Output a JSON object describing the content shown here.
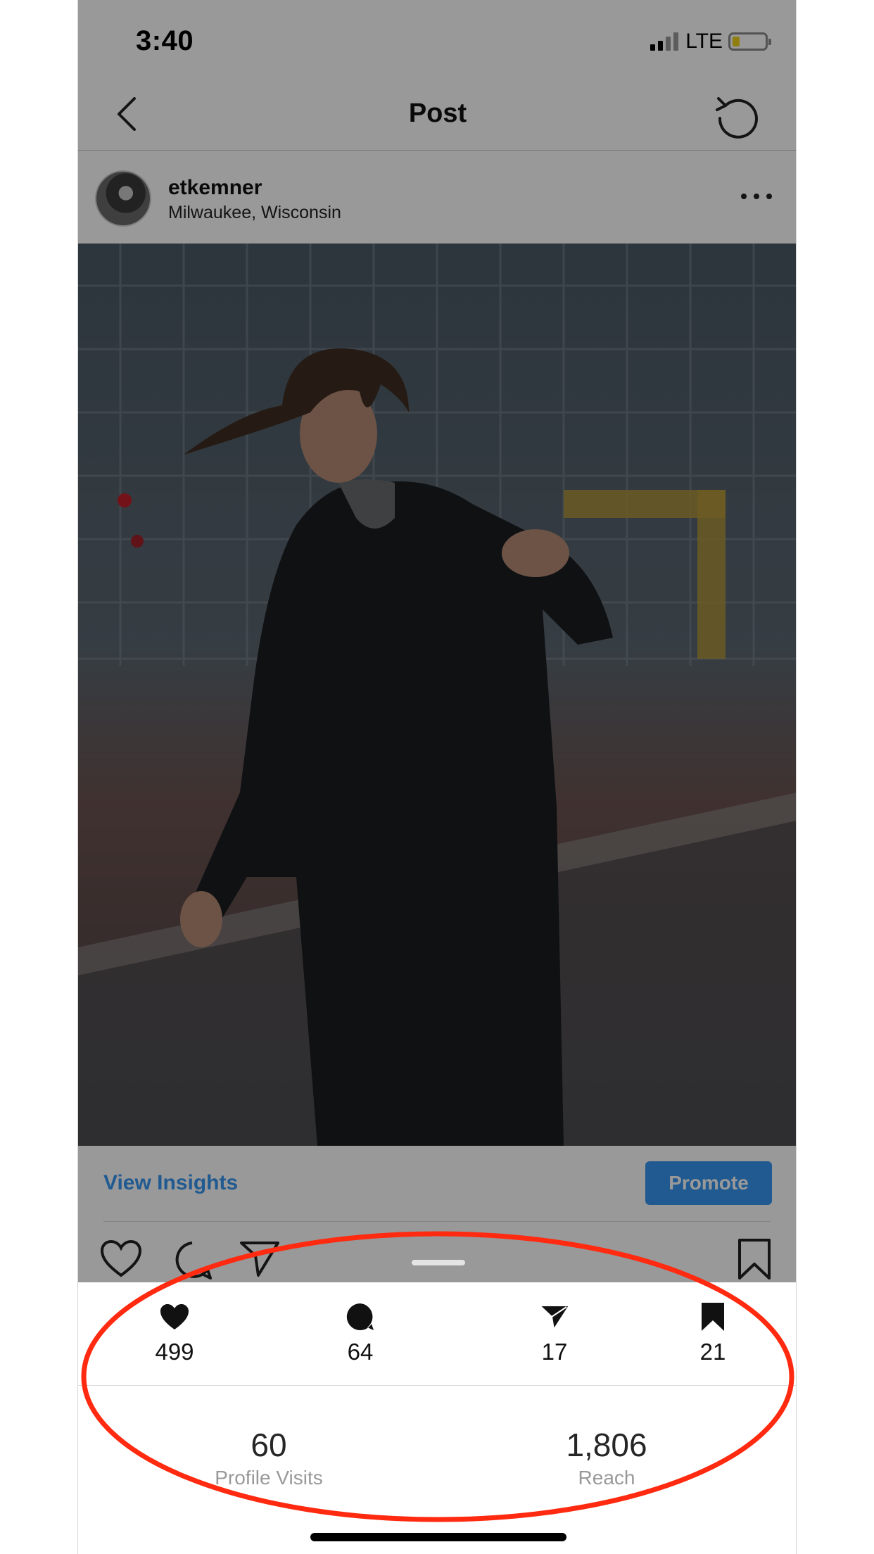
{
  "status_bar": {
    "time": "3:40",
    "network": "LTE"
  },
  "nav": {
    "title": "Post"
  },
  "post": {
    "username": "etkemner",
    "location": "Milwaukee, Wisconsin"
  },
  "insights_row": {
    "view_insights": "View Insights",
    "promote": "Promote"
  },
  "metrics": [
    {
      "icon": "heart-icon",
      "value": "499"
    },
    {
      "icon": "comment-icon",
      "value": "64"
    },
    {
      "icon": "share-icon",
      "value": "17"
    },
    {
      "icon": "bookmark-icon",
      "value": "21"
    }
  ],
  "stats": [
    {
      "value": "60",
      "label": "Profile Visits"
    },
    {
      "value": "1,806",
      "label": "Reach"
    }
  ],
  "colors": {
    "link": "#3897f0",
    "annotation": "#ff2a10",
    "dim_overlay": "rgba(0,0,0,0.4)"
  }
}
